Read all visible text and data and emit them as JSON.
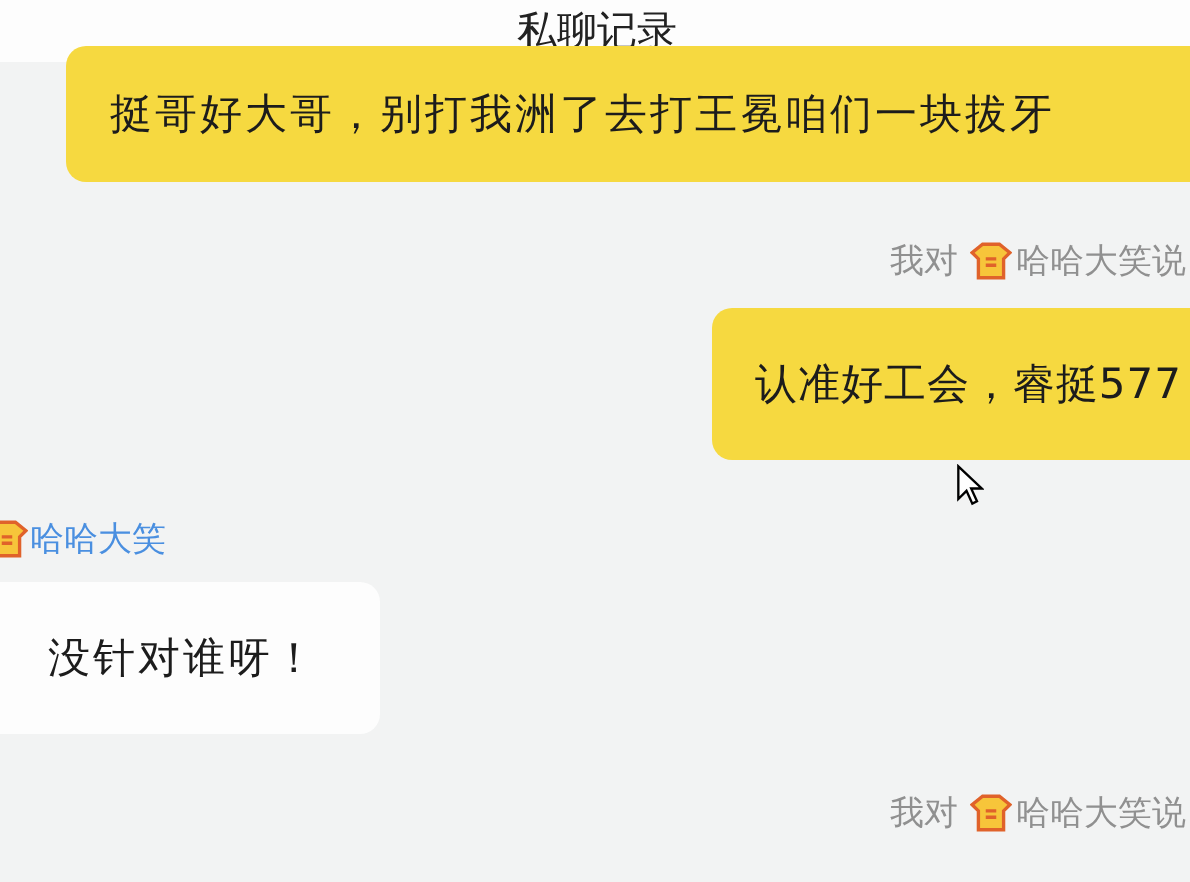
{
  "header": {
    "title": "私聊记录"
  },
  "messages": [
    {
      "kind": "outgoing",
      "text": "挺哥好大哥，别打我洲了去打王冕咱们一块拔牙"
    },
    {
      "kind": "outgoing",
      "meta": {
        "prefix": "我对",
        "name": "哈哈大笑说"
      },
      "text": "认准好工会，睿挺577"
    },
    {
      "kind": "incoming",
      "sender": "哈哈大笑",
      "text": "没针对谁呀！"
    },
    {
      "kind": "outgoing",
      "meta": {
        "prefix": "我对",
        "name": "哈哈大笑说"
      }
    }
  ]
}
